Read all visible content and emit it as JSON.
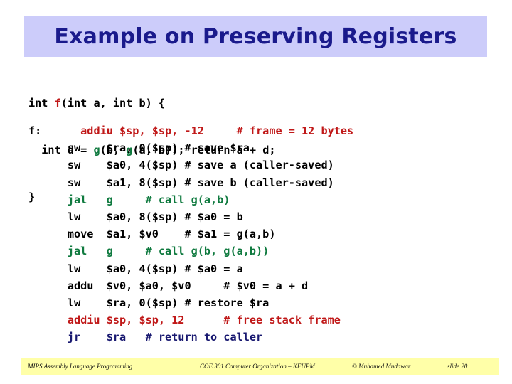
{
  "slide": {
    "title": "Example on Preserving Registers",
    "title_bg": "#ccccfa",
    "title_color": "#1a1a8c"
  },
  "colors": {
    "red": "#c01818",
    "green": "#0f7a3f",
    "blue": "#181870",
    "black": "#000000",
    "footer_bg": "#ffffa8"
  },
  "c_code": {
    "line1_a": "int ",
    "line1_f": "f",
    "line1_b": "(int a, int b) {",
    "line2_a": "  int d = ",
    "line2_g1": "g",
    "line2_b": "(b, ",
    "line2_g2": "g",
    "line2_c": "(a, b)); return a + d;",
    "line3": "}"
  },
  "asm_code": {
    "lines": [
      {
        "label": "f:",
        "text": "      addiu $sp, $sp, -12     # frame = 12 bytes",
        "color": "red"
      },
      {
        "label": "",
        "text": "      sw    $ra, 0($sp) # save $ra",
        "color": "black"
      },
      {
        "label": "",
        "text": "      sw    $a0, 4($sp) # save a (caller-saved)",
        "color": "black"
      },
      {
        "label": "",
        "text": "      sw    $a1, 8($sp) # save b (caller-saved)",
        "color": "black"
      },
      {
        "label": "",
        "text": "      jal   g     # call g(a,b)",
        "color": "green"
      },
      {
        "label": "",
        "text": "      lw    $a0, 8($sp) # $a0 = b",
        "color": "black"
      },
      {
        "label": "",
        "text": "      move  $a1, $v0    # $a1 = g(a,b)",
        "color": "black"
      },
      {
        "label": "",
        "text": "      jal   g     # call g(b, g(a,b))",
        "color": "green"
      },
      {
        "label": "",
        "text": "      lw    $a0, 4($sp) # $a0 = a",
        "color": "black"
      },
      {
        "label": "",
        "text": "      addu  $v0, $a0, $v0     # $v0 = a + d",
        "color": "black"
      },
      {
        "label": "",
        "text": "      lw    $ra, 0($sp) # restore $ra",
        "color": "black"
      },
      {
        "label": "",
        "text": "      addiu $sp, $sp, 12      # free stack frame",
        "color": "red"
      },
      {
        "label": "",
        "text": "      jr    $ra   # return to caller",
        "color": "blue"
      }
    ]
  },
  "footer": {
    "left": "MIPS Assembly Language Programming",
    "center": "COE 301 Computer Organization – KFUPM",
    "right": "© Muhamed Mudawar",
    "slide_number": "slide 20"
  }
}
